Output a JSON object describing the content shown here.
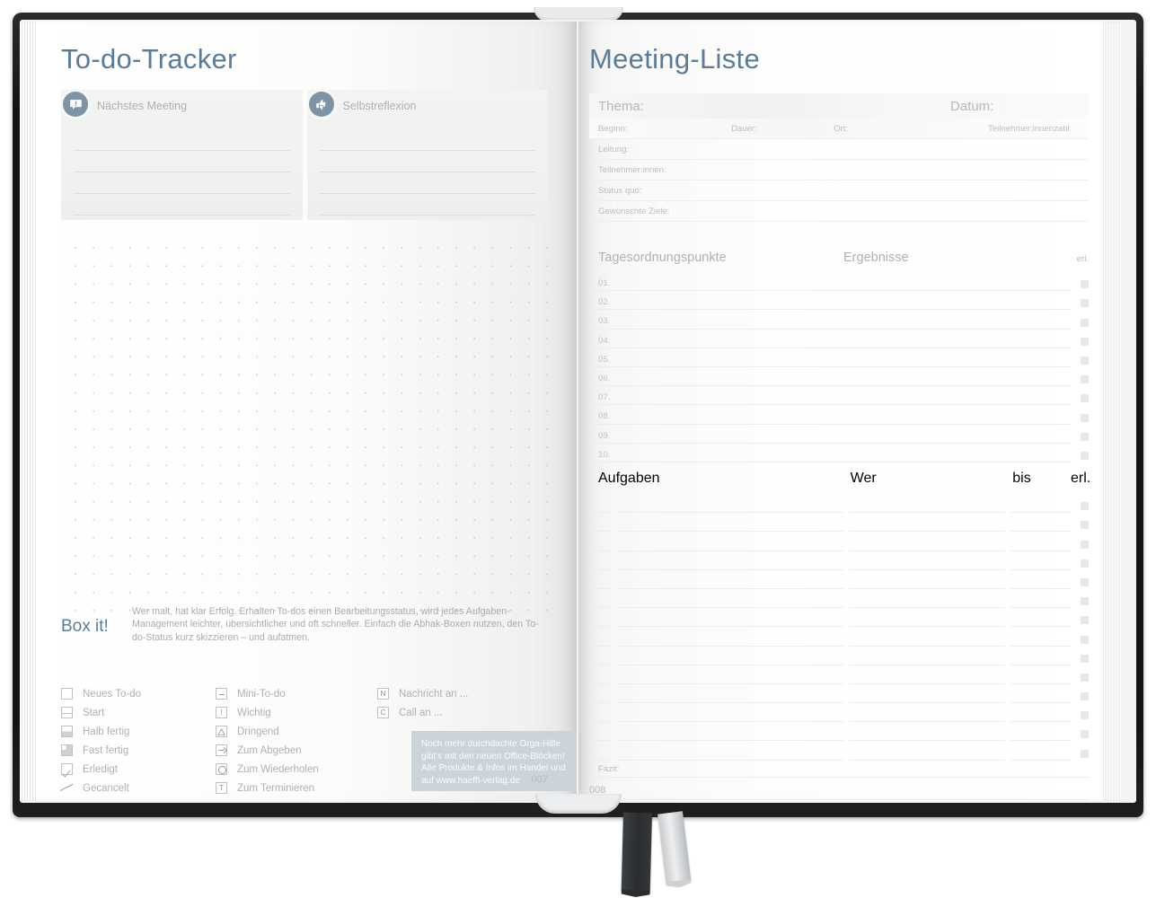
{
  "notebook": {
    "ribbons": [
      "bookmark-ribbon-dark",
      "bookmark-ribbon-silver"
    ],
    "accent_color": "#5b7c99",
    "badge_color": "#7d93a6",
    "ad_color": "#ccd4da"
  },
  "left_page": {
    "title": "To-do-Tracker",
    "page_number": "007",
    "boxes": [
      {
        "icon": "speech-bubble-alert-icon",
        "label": "Nächstes Meeting",
        "lines": 4
      },
      {
        "icon": "thumbs-up-down-icon",
        "label": "Selbstreflexion",
        "lines": 4
      }
    ],
    "boxit": {
      "title": "Box it!",
      "text": "Wer malt, hat klar Erfolg. Erhalten To-dos einen Bearbeitungsstatus, wird jedes Aufgaben-Management leichter, übersichtlicher und oft schneller. Einfach die Abhak-Boxen nutzen, den To-do-Status kurz skizzieren – und aufatmen."
    },
    "legend": {
      "column1": [
        {
          "icon": "empty-box-icon",
          "label": "Neues To-do"
        },
        {
          "icon": "box-half-line-icon",
          "label": "Start"
        },
        {
          "icon": "box-half-filled-icon",
          "label": "Halb fertig"
        },
        {
          "icon": "box-almost-filled-icon",
          "label": "Fast fertig"
        },
        {
          "icon": "box-check-icon",
          "label": "Erledigt"
        },
        {
          "icon": "strikethrough-icon",
          "label": "Gecancelt"
        }
      ],
      "column2": [
        {
          "icon": "box-minus-icon",
          "label": "Mini-To-do"
        },
        {
          "icon": "box-exclamation-icon",
          "label": "Wichtig",
          "glyph": "!"
        },
        {
          "icon": "box-triangle-icon",
          "label": "Dringend"
        },
        {
          "icon": "box-arrow-right-icon",
          "label": "Zum Abgeben"
        },
        {
          "icon": "box-circle-icon",
          "label": "Zum Wiederholen"
        },
        {
          "icon": "box-letter-t-icon",
          "label": "Zum Terminieren",
          "glyph": "T"
        }
      ],
      "column3": [
        {
          "icon": "box-letter-n-icon",
          "label": "Nachricht an ...",
          "glyph": "N"
        },
        {
          "icon": "box-letter-c-icon",
          "label": "Call an ...",
          "glyph": "C"
        }
      ]
    },
    "ad": {
      "text": "Noch mehr durchdachte Orga-Hilfe gibt’s mit den neuen Office-Blöcken! Alle Produkte & Infos im Handel und auf www.haefft-verlag.de"
    }
  },
  "right_page": {
    "title": "Meeting-Liste",
    "page_number": "008",
    "meta": {
      "thema": "Thema:",
      "datum": "Datum:",
      "beginn": "Beginn:",
      "dauer": "Dauer:",
      "ort": "Ort:",
      "teilnehmerzahl": "Teilnehmer:innenzahl:",
      "leitung": "Leitung:",
      "teilnehmer": "Teilnehmer:innen:",
      "status_quo": "Status quo:",
      "ziele": "Gewünschte Ziele:"
    },
    "agenda": {
      "col_items": "Tagesordnungspunkte",
      "col_results": "Ergebnisse",
      "col_done": "erl.",
      "rows": [
        "01.",
        "02.",
        "03.",
        "04.",
        "05.",
        "06.",
        "07.",
        "08.",
        "09.",
        "10."
      ]
    },
    "tasks": {
      "col_task": "Aufgaben",
      "col_who": "Wer",
      "col_until": "bis",
      "col_done": "erl.",
      "row_count": 14
    },
    "fazit": "Fazit:"
  }
}
